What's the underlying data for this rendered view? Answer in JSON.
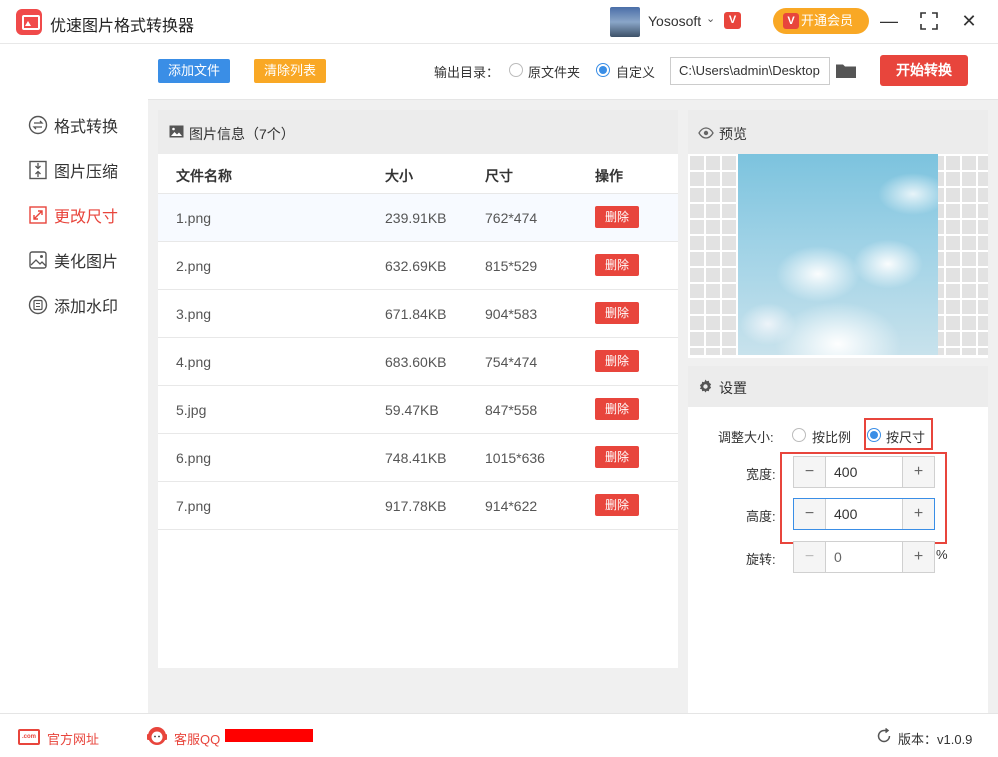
{
  "app": {
    "title": "优速图片格式转换器",
    "username": "Yososoft",
    "vip_label": "开通会员"
  },
  "sidebar": {
    "items": [
      {
        "label": "格式转换",
        "icon": "swap-icon"
      },
      {
        "label": "图片压缩",
        "icon": "compress-icon"
      },
      {
        "label": "更改尺寸",
        "icon": "resize-icon",
        "active": true
      },
      {
        "label": "美化图片",
        "icon": "beautify-icon"
      },
      {
        "label": "添加水印",
        "icon": "watermark-icon"
      }
    ]
  },
  "toolbar": {
    "add_files": "添加文件",
    "clear_list": "清除列表",
    "output_label": "输出目录：",
    "option_source": "原文件夹",
    "option_custom": "自定义",
    "selected_option": "自定义",
    "output_path": "C:\\Users\\admin\\Desktop",
    "start": "开始转换"
  },
  "file_list": {
    "title": "图片信息（7个）",
    "columns": [
      "文件名称",
      "大小",
      "尺寸",
      "操作"
    ],
    "delete_label": "删除",
    "rows": [
      {
        "name": "1.png",
        "size": "239.91KB",
        "dims": "762*474"
      },
      {
        "name": "2.png",
        "size": "632.69KB",
        "dims": "815*529"
      },
      {
        "name": "3.png",
        "size": "671.84KB",
        "dims": "904*583"
      },
      {
        "name": "4.png",
        "size": "683.60KB",
        "dims": "754*474"
      },
      {
        "name": "5.jpg",
        "size": "59.47KB",
        "dims": "847*558"
      },
      {
        "name": "6.png",
        "size": "748.41KB",
        "dims": "1015*636"
      },
      {
        "name": "7.png",
        "size": "917.78KB",
        "dims": "914*622"
      }
    ]
  },
  "preview": {
    "title": "预览"
  },
  "settings": {
    "title": "设置",
    "resize_label": "调整大小:",
    "option_ratio": "按比例",
    "option_size": "按尺寸",
    "selected_option": "按尺寸",
    "width_label": "宽度:",
    "width_value": "400",
    "height_label": "高度:",
    "height_value": "400",
    "rotate_label": "旋转:",
    "rotate_value": "0",
    "rotate_unit": "%",
    "minus": "−",
    "plus": "+"
  },
  "footer": {
    "website": "官方网址",
    "support": "客服QQ",
    "version": "版本：v1.0.9"
  },
  "colors": {
    "accent_red": "#e8453c",
    "accent_blue": "#3a8ee6",
    "accent_orange": "#f9a825"
  }
}
